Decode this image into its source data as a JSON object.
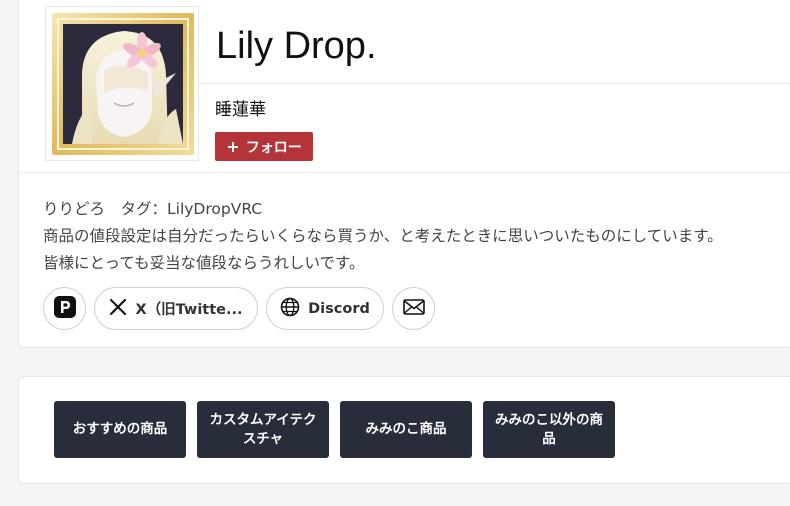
{
  "shop": {
    "title": "Lily Drop.",
    "subtitle": "睡蓮華",
    "follow_label": "フォロー",
    "follow_color": "#b5343a"
  },
  "description": {
    "line1": "りりどろ　タグ：LilyDropVRC",
    "line2": "商品の値段設定は自分だったらいくらなら買うか、と考えたときに思いついたものにしています。",
    "line3": "皆様にとっても妥当な値段ならうれしいです。"
  },
  "links": [
    {
      "icon": "pixiv-icon",
      "label": ""
    },
    {
      "icon": "x-icon",
      "label": "X（旧Twitte..."
    },
    {
      "icon": "globe-icon",
      "label": "Discord"
    },
    {
      "icon": "mail-icon",
      "label": ""
    }
  ],
  "categories": [
    "おすすめの商品",
    "カスタムアイテクスチャ",
    "みみのこ商品",
    "みみのこ以外の商品"
  ],
  "colors": {
    "category_bg": "#272d3a",
    "page_bg": "#f5f5f5"
  }
}
